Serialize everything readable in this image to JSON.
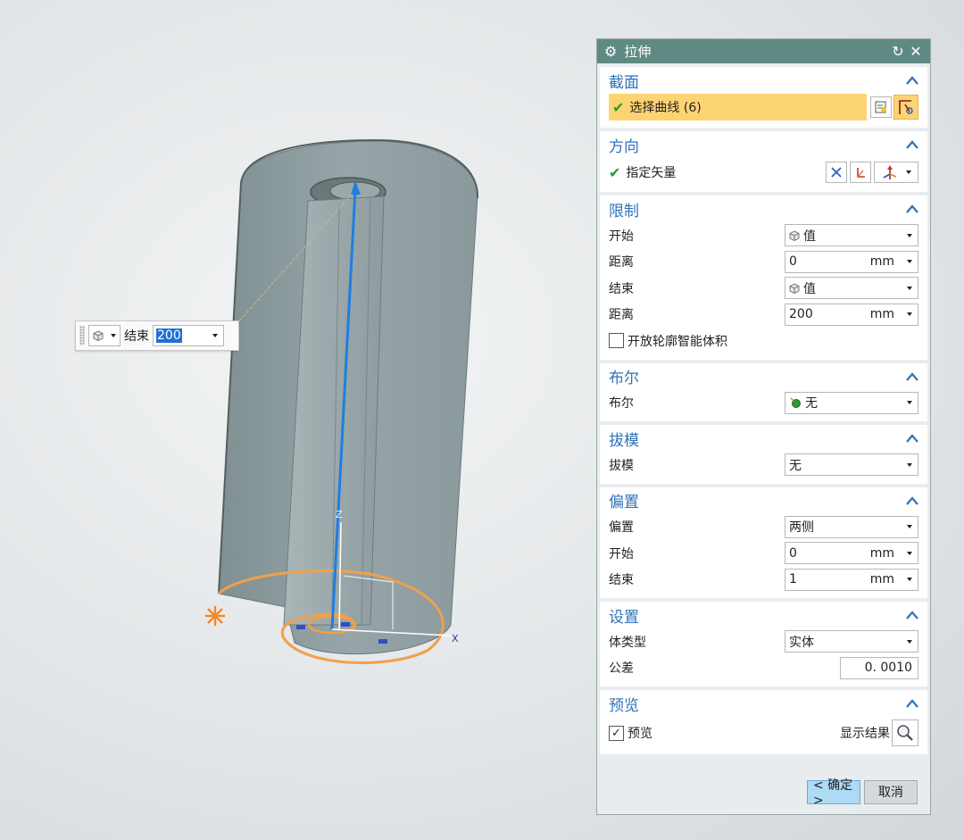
{
  "float_input": {
    "label": "结束",
    "value": "200"
  },
  "viewport": {
    "axis_z": "Z",
    "axis_x": "X"
  },
  "dialog": {
    "title": "拉伸",
    "sections": {
      "section": {
        "title": "截面",
        "select_curve": "选择曲线 (6)"
      },
      "direction": {
        "title": "方向",
        "vector": "指定矢量"
      },
      "limits": {
        "title": "限制",
        "start_label": "开始",
        "start_value": "值",
        "distance1_label": "距离",
        "distance1_value": "0",
        "distance1_unit": "mm",
        "end_label": "结束",
        "end_value": "值",
        "distance2_label": "距离",
        "distance2_value": "200",
        "distance2_unit": "mm",
        "open_profile_label": "开放轮廓智能体积"
      },
      "boolean": {
        "title": "布尔",
        "label": "布尔",
        "value": "无"
      },
      "draft": {
        "title": "拔模",
        "label": "拔模",
        "value": "无"
      },
      "offset": {
        "title": "偏置",
        "label": "偏置",
        "value": "两侧",
        "start_label": "开始",
        "start_value": "0",
        "start_unit": "mm",
        "end_label": "结束",
        "end_value": "1",
        "end_unit": "mm"
      },
      "settings": {
        "title": "设置",
        "body_type_label": "体类型",
        "body_type_value": "实体",
        "tolerance_label": "公差",
        "tolerance_value": "0. 0010"
      },
      "preview": {
        "title": "预览",
        "preview_label": "预览",
        "show_result_label": "显示结果"
      }
    },
    "buttons": {
      "ok": "< 确定 >",
      "cancel": "取消"
    }
  },
  "colors": {
    "titlebar": "#5f8a83",
    "section_title": "#2f73b8",
    "highlight": "#fcd472",
    "model": "#8e9c9f",
    "curve": "#f0a04b",
    "vector": "#1e7fe0"
  }
}
